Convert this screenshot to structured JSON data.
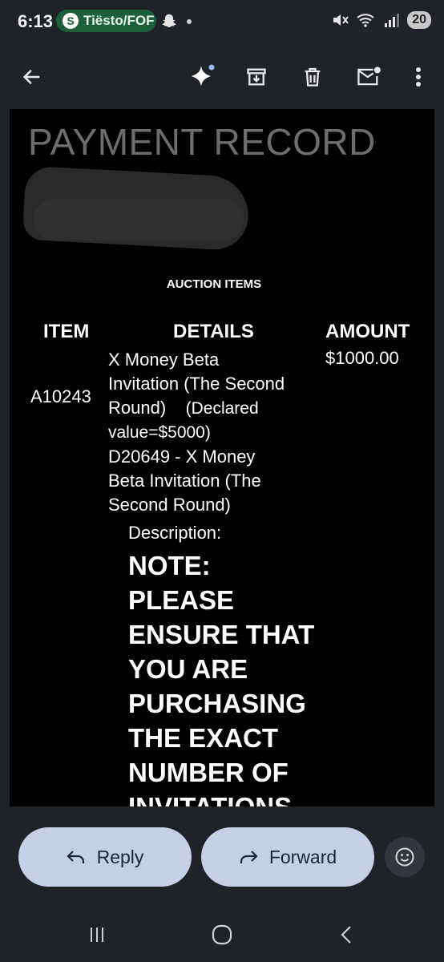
{
  "status_bar": {
    "time": "6:13",
    "notification_app": "Tiësto/FOF",
    "battery": "20"
  },
  "toolbar": {
    "icons": [
      "back-arrow-icon",
      "sparkle-icon",
      "archive-icon",
      "delete-icon",
      "mark-unread-icon",
      "more-vert-icon"
    ]
  },
  "email": {
    "title": "PAYMENT RECORD",
    "section_label": "AUCTION ITEMS",
    "columns": {
      "item": "ITEM",
      "details": "DETAILS",
      "amount": "AMOUNT"
    },
    "row": {
      "item_code": "A10243",
      "details_line1": "X Money Beta",
      "details_line2": "Invitation (The Second",
      "details_line3": "Round)",
      "details_declared": "(Declared",
      "details_line4": "value=$5000)",
      "details_line5": "D20649 - X Money",
      "details_line6": "Beta Invitation (The",
      "details_line7": "Second Round)",
      "amount": "$1000.00"
    },
    "description_label": "Description:",
    "note_lines": [
      "NOTE:",
      "PLEASE",
      "ENSURE THAT",
      "YOU ARE",
      "PURCHASING",
      "THE EXACT",
      "NUMBER OF",
      "INVITATIONS"
    ]
  },
  "actions": {
    "reply_label": "Reply",
    "forward_label": "Forward"
  },
  "colors": {
    "background": "#1f2227",
    "pill_button": "#c7cfe6",
    "status_pill": "#1c5f3d",
    "title_gray": "#6d6d6d"
  }
}
